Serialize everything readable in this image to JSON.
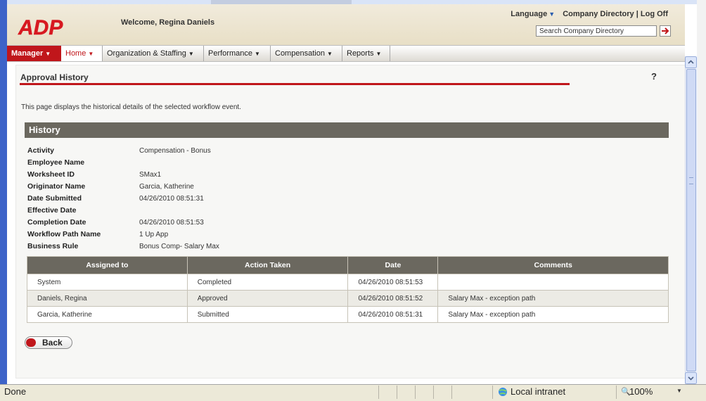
{
  "header": {
    "welcome": "Welcome, Regina Daniels",
    "language_label": "Language",
    "company_directory": "Company Directory",
    "separator": "|",
    "log_off": "Log Off",
    "search_placeholder": "Search Company Directory",
    "logo_text": "ADP"
  },
  "nav": {
    "items": [
      {
        "label": "Manager"
      },
      {
        "label": "Home"
      },
      {
        "label": "Organization & Staffing"
      },
      {
        "label": "Performance"
      },
      {
        "label": "Compensation"
      },
      {
        "label": "Reports"
      }
    ]
  },
  "page": {
    "title": "Approval History",
    "help": "?",
    "description": "This page displays the historical details of the selected workflow event.",
    "section_title": "History"
  },
  "details": [
    {
      "label": "Activity",
      "value": "Compensation - Bonus"
    },
    {
      "label": "Employee Name",
      "value": ""
    },
    {
      "label": "Worksheet ID",
      "value": "SMax1"
    },
    {
      "label": "Originator Name",
      "value": "Garcia, Katherine"
    },
    {
      "label": "Date Submitted",
      "value": "04/26/2010 08:51:31"
    },
    {
      "label": "Effective Date",
      "value": ""
    },
    {
      "label": "Completion Date",
      "value": "04/26/2010 08:51:53"
    },
    {
      "label": "Workflow Path Name",
      "value": "1 Up App"
    },
    {
      "label": "Business Rule",
      "value": "Bonus Comp- Salary Max"
    }
  ],
  "history_table": {
    "columns": [
      "Assigned to",
      "Action Taken",
      "Date",
      "Comments"
    ],
    "rows": [
      [
        "System",
        "Completed",
        "04/26/2010 08:51:53",
        ""
      ],
      [
        "Daniels, Regina",
        "Approved",
        "04/26/2010 08:51:52",
        "Salary Max - exception path"
      ],
      [
        "Garcia, Katherine",
        "Submitted",
        "04/26/2010 08:51:31",
        "Salary Max - exception path"
      ]
    ]
  },
  "buttons": {
    "back": "Back"
  },
  "statusbar": {
    "status": "Done",
    "zone": "Local intranet",
    "zoom": "100%"
  },
  "colors": {
    "brand_red": "#c0161b",
    "section_gray": "#6b685f",
    "header_beige": "#e8dfc6"
  }
}
